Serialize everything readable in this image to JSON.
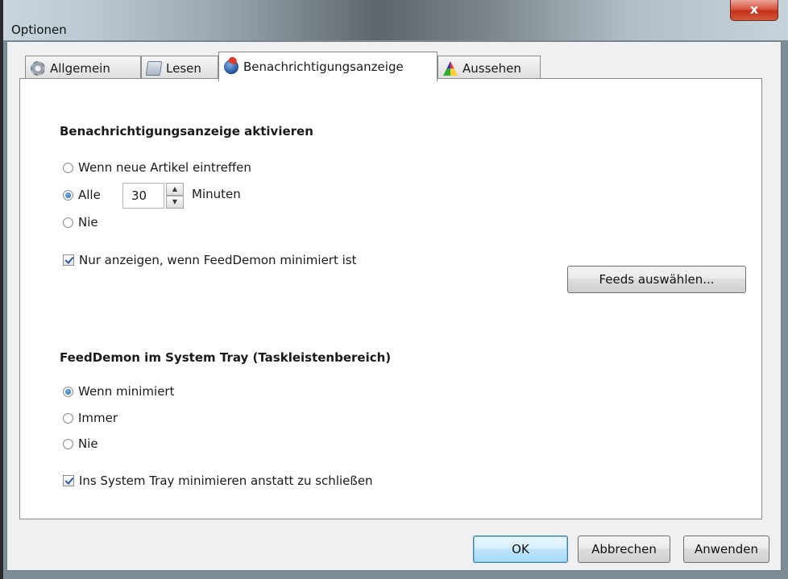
{
  "window": {
    "title": "Optionen",
    "close_label": "x"
  },
  "tabs": [
    {
      "label": "Allgemein",
      "icon": "gear-icon"
    },
    {
      "label": "Lesen",
      "icon": "read-icon"
    },
    {
      "label": "Benachrichtigungsanzeige",
      "icon": "notification-icon",
      "selected": true
    },
    {
      "label": "Aussehen",
      "icon": "appearance-icon"
    }
  ],
  "notification": {
    "heading": "Benachrichtigungsanzeige aktivieren",
    "opt_new_articles": "Wenn neue Artikel eintreffen",
    "opt_every": "Alle",
    "interval_value": "30",
    "interval_unit": "Minuten",
    "opt_never": "Nie",
    "selected": "Alle",
    "only_minimized_label": "Nur anzeigen, wenn FeedDemon minimiert ist",
    "only_minimized_checked": true,
    "select_feeds_button": "Feeds auswählen..."
  },
  "tray": {
    "heading": "FeedDemon im System Tray (Taskleistenbereich)",
    "opt_minimized": "Wenn minimiert",
    "opt_always": "Immer",
    "opt_never": "Nie",
    "selected": "Wenn minimiert",
    "minimize_to_tray_label": "Ins System Tray minimieren anstatt zu schließen",
    "minimize_to_tray_checked": true
  },
  "footer": {
    "ok": "OK",
    "cancel": "Abbrechen",
    "apply": "Anwenden"
  }
}
